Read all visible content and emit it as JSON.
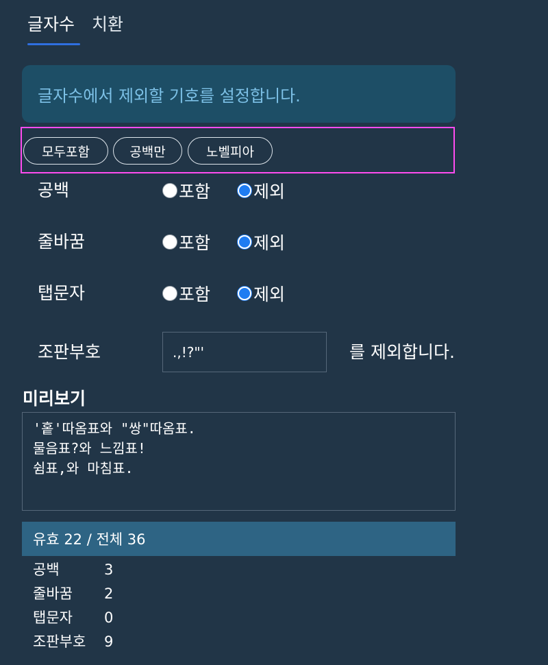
{
  "tabs": [
    {
      "label": "글자수",
      "active": true
    },
    {
      "label": "치환",
      "active": false
    }
  ],
  "banner": {
    "text": "글자수에서 제외할 기호를 설정합니다."
  },
  "presets": [
    {
      "label": "모두포함"
    },
    {
      "label": "공백만"
    },
    {
      "label": "노벨피아"
    }
  ],
  "options": [
    {
      "label": "공백",
      "include_label": "포함",
      "exclude_label": "제외",
      "selected": "exclude"
    },
    {
      "label": "줄바꿈",
      "include_label": "포함",
      "exclude_label": "제외",
      "selected": "exclude"
    },
    {
      "label": "탭문자",
      "include_label": "포함",
      "exclude_label": "제외",
      "selected": "exclude"
    }
  ],
  "punctuation": {
    "label": "조판부호",
    "value": ".,!?\"'",
    "suffix": "를 제외합니다."
  },
  "preview": {
    "title": "미리보기",
    "text": "'홑'따옴표와 \"쌍\"따옴표.\n물음표?와 느낌표!\n쉼표,와 마침표."
  },
  "stats": {
    "header": "유효 22 / 전체 36",
    "rows": [
      {
        "label": "공백",
        "value": "3"
      },
      {
        "label": "줄바꿈",
        "value": "2"
      },
      {
        "label": "탭문자",
        "value": "0"
      },
      {
        "label": "조판부호",
        "value": "9"
      }
    ]
  },
  "colors": {
    "background": "#213547",
    "accent": "#2f6fe0",
    "banner_bg": "#1d4e66",
    "banner_text": "#7cc0e6",
    "highlight_border": "#ff4cf0",
    "radio_checked": "#1e7cf2",
    "stats_header_bg": "#2e6484"
  }
}
